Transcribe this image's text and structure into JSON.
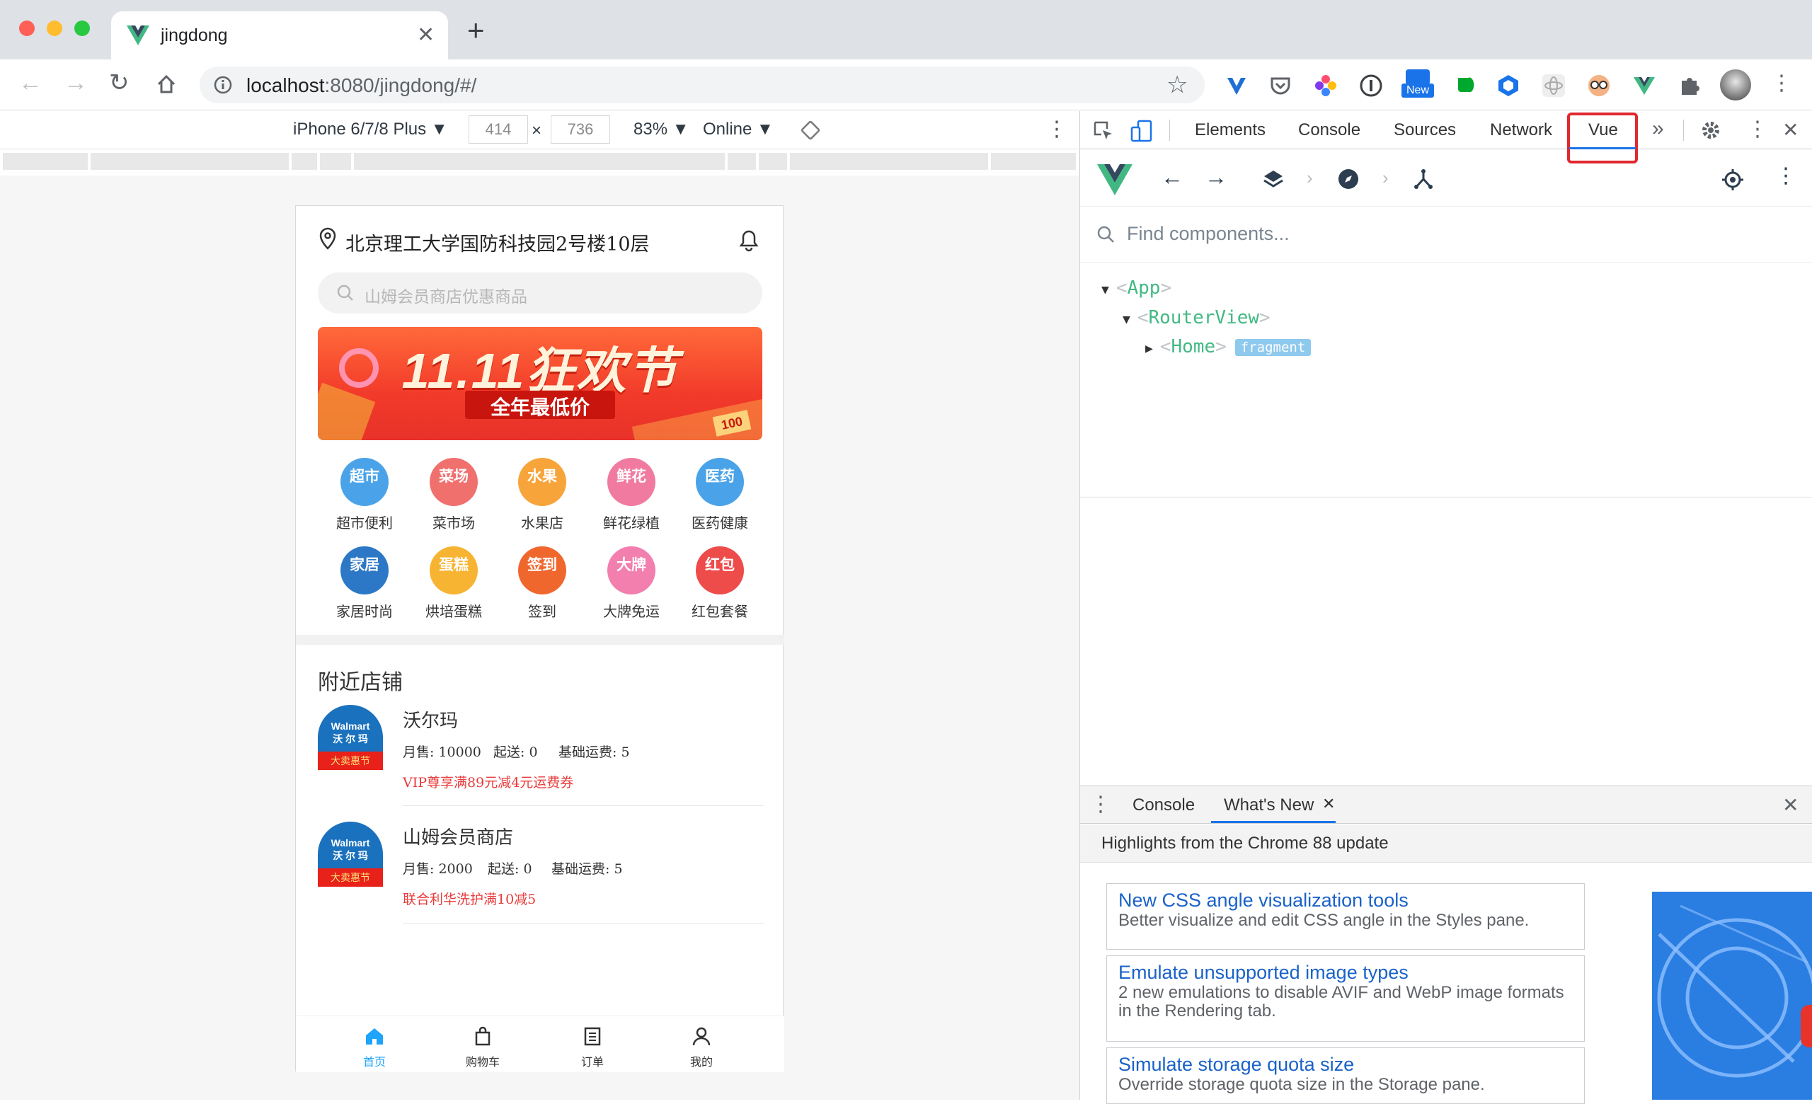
{
  "browser": {
    "tab_title": "jingdong",
    "url_host": "localhost",
    "url_rest": ":8080/jingdong/#/",
    "new_badge": "New"
  },
  "device_toolbar": {
    "device": "iPhone 6/7/8 Plus ▼",
    "width": "414",
    "times": "×",
    "height": "736",
    "zoom": "83% ▼",
    "network": "Online ▼"
  },
  "app": {
    "location": "北京理工大学国防科技园2号楼10层",
    "search_placeholder": "山姆会员商店优惠商品",
    "banner_main": "11.11狂欢节",
    "banner_sub": "全年最低价",
    "banner_tag": "100",
    "categories": [
      {
        "icon_text": "超市",
        "label": "超市便利",
        "color": "#4aa3e8"
      },
      {
        "icon_text": "菜场",
        "label": "菜市场",
        "color": "#f0706e"
      },
      {
        "icon_text": "水果",
        "label": "水果店",
        "color": "#f7a43a"
      },
      {
        "icon_text": "鲜花",
        "label": "鲜花绿植",
        "color": "#f07aa0"
      },
      {
        "icon_text": "医药",
        "label": "医药健康",
        "color": "#4aa3e8"
      },
      {
        "icon_text": "家居",
        "label": "家居时尚",
        "color": "#2c78c7"
      },
      {
        "icon_text": "蛋糕",
        "label": "烘培蛋糕",
        "color": "#f7b432"
      },
      {
        "icon_text": "签到",
        "label": "签到",
        "color": "#f0672e"
      },
      {
        "icon_text": "大牌",
        "label": "大牌免运",
        "color": "#f27fae"
      },
      {
        "icon_text": "红包",
        "label": "红包套餐",
        "color": "#ee4b4b"
      }
    ],
    "nearby_title": "附近店铺",
    "shops": [
      {
        "name": "沃尔玛",
        "sales": "月售: 10000",
        "min": "起送: 0",
        "fee": "基础运费: 5",
        "promo": "VIP尊享满89元减4元运费券",
        "logo_en": "Walmart",
        "logo_cn": "沃 尔 玛",
        "logo_tag": "大卖惠节"
      },
      {
        "name": "山姆会员商店",
        "sales": "月售: 2000",
        "min": "起送: 0",
        "fee": "基础运费: 5",
        "promo": "联合利华洗护满10减5",
        "logo_en": "Walmart",
        "logo_cn": "沃 尔 玛",
        "logo_tag": "大卖惠节"
      }
    ],
    "dock": [
      {
        "label": "首页",
        "icon": "home-icon",
        "active": true
      },
      {
        "label": "购物车",
        "icon": "bag-icon",
        "active": false
      },
      {
        "label": "订单",
        "icon": "order-icon",
        "active": false
      },
      {
        "label": "我的",
        "icon": "user-icon",
        "active": false
      }
    ],
    "accent": "#1fa4fc"
  },
  "devtools": {
    "tabs": [
      "Elements",
      "Console",
      "Sources",
      "Network",
      "Vue"
    ],
    "more": "»",
    "find_placeholder": "Find components...",
    "tree": {
      "app": "App",
      "router": "RouterView",
      "home": "Home",
      "badge": "fragment"
    },
    "drawer_tabs": [
      "Console",
      "What's New"
    ],
    "highlights": "Highlights from the Chrome 88 update",
    "cards": [
      {
        "title": "New CSS angle visualization tools",
        "desc": "Better visualize and edit CSS angle in the Styles pane."
      },
      {
        "title": "Emulate unsupported image types",
        "desc": "2 new emulations to disable AVIF and WebP image formats in the Rendering tab."
      },
      {
        "title": "Simulate storage quota size",
        "desc": "Override storage quota size in the Storage pane."
      }
    ]
  }
}
